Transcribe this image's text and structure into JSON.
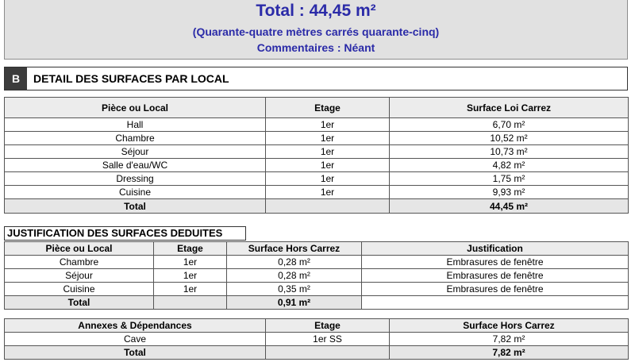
{
  "summary": {
    "total": "Total : 44,45 m²",
    "words": "(Quarante-quatre mètres carrés quarante-cinq)",
    "comments": "Commentaires : Néant"
  },
  "section_b": {
    "letter": "B",
    "title": "DETAIL DES SURFACES PAR LOCAL"
  },
  "rooms_table": {
    "headers": [
      "Pièce ou Local",
      "Etage",
      "Surface Loi Carrez"
    ],
    "rows": [
      [
        "Hall",
        "1er",
        "6,70 m²"
      ],
      [
        "Chambre",
        "1er",
        "10,52 m²"
      ],
      [
        "Séjour",
        "1er",
        "10,73 m²"
      ],
      [
        "Salle d'eau/WC",
        "1er",
        "4,82 m²"
      ],
      [
        "Dressing",
        "1er",
        "1,75 m²"
      ],
      [
        "Cuisine",
        "1er",
        "9,93 m²"
      ]
    ],
    "total_label": "Total",
    "total_value": "44,45 m²"
  },
  "justification": {
    "title": "JUSTIFICATION DES SURFACES DEDUITES",
    "headers": [
      "Pièce ou Local",
      "Etage",
      "Surface Hors Carrez",
      "Justification"
    ],
    "rows": [
      [
        "Chambre",
        "1er",
        "0,28 m²",
        "Embrasures de fenêtre"
      ],
      [
        "Séjour",
        "1er",
        "0,28 m²",
        "Embrasures de fenêtre"
      ],
      [
        "Cuisine",
        "1er",
        "0,35 m²",
        "Embrasures de fenêtre"
      ]
    ],
    "total_label": "Total",
    "total_value": "0,91 m²"
  },
  "annexes": {
    "headers": [
      "Annexes & Dépendances",
      "Etage",
      "Surface Hors Carrez"
    ],
    "rows": [
      [
        "Cave",
        "1er SS",
        "7,82 m²"
      ]
    ],
    "total_label": "Total",
    "total_value": "7,82 m²"
  }
}
